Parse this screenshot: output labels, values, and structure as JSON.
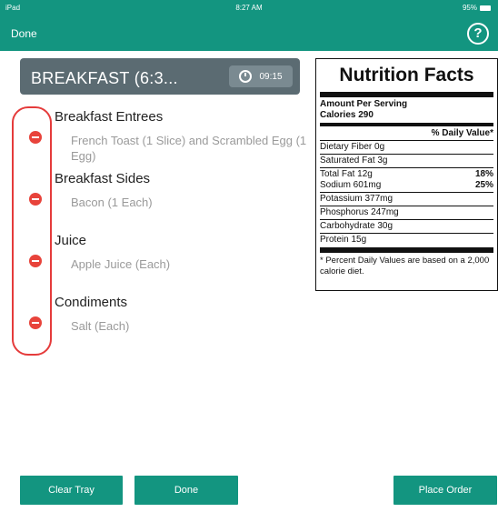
{
  "status_bar": {
    "device": "iPad",
    "time": "8:27 AM",
    "battery": "95%"
  },
  "nav": {
    "done_label": "Done",
    "help_symbol": "?"
  },
  "meal": {
    "title": "BREAKFAST (6:3...",
    "time": "09:15"
  },
  "categories": [
    {
      "name": "Breakfast Entrees",
      "item": "French Toast (1 Slice) and Scrambled Egg (1 Egg)"
    },
    {
      "name": "Breakfast Sides",
      "item": "Bacon (1 Each)"
    },
    {
      "name": "Juice",
      "item": "Apple Juice (Each)"
    },
    {
      "name": "Condiments",
      "item": "Salt (Each)"
    }
  ],
  "nutrition": {
    "title": "Nutrition Facts",
    "amount_per_serving": "Amount Per Serving",
    "calories": "Calories 290",
    "daily_value_header": "% Daily Value*",
    "rows": [
      {
        "label": "Dietary Fiber  0g",
        "pct": ""
      },
      {
        "label": "Saturated Fat  3g",
        "pct": ""
      },
      {
        "label": "Total Fat  12g",
        "pct": "18%"
      },
      {
        "label": "Sodium  601mg",
        "pct": "25%"
      },
      {
        "label": "Potassium  377mg",
        "pct": ""
      },
      {
        "label": "Phosphorus  247mg",
        "pct": ""
      },
      {
        "label": "Carbohydrate  30g",
        "pct": ""
      },
      {
        "label": "Protein  15g",
        "pct": ""
      }
    ],
    "footnote": "* Percent Daily Values are based on a 2,000 calorie diet."
  },
  "buttons": {
    "clear_tray": "Clear Tray",
    "done": "Done",
    "place_order": "Place Order"
  },
  "colors": {
    "accent": "#139580",
    "meal_header": "#5b6b72",
    "remove": "#e8433b",
    "outline": "#e53b3b"
  }
}
